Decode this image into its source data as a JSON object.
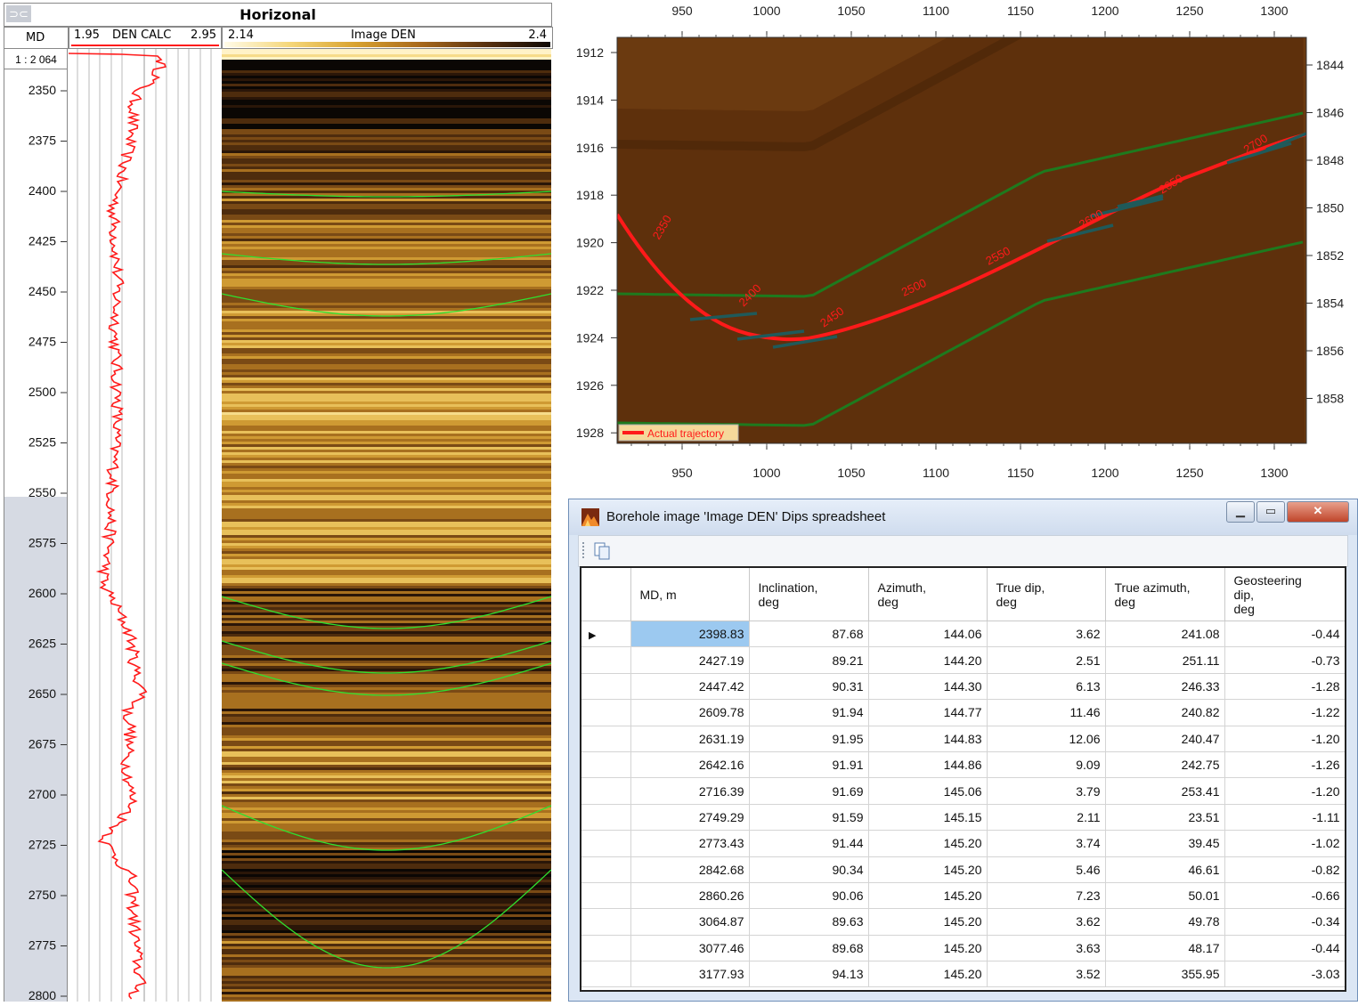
{
  "log_panel": {
    "title": "Horizonal",
    "depth_header": "MD",
    "scale": "1 : 2 064",
    "curve_header": {
      "min": "1.95",
      "name": "DEN CALC",
      "max": "2.95"
    },
    "image_header": {
      "min": "2.14",
      "name": "Image DEN",
      "max": "2.4"
    },
    "depth_labels": [
      "2350",
      "2375",
      "2400",
      "2425",
      "2450",
      "2475",
      "2500",
      "2525",
      "2550",
      "2575",
      "2600",
      "2625",
      "2650",
      "2675",
      "2700",
      "2725",
      "2750",
      "2775",
      "2800"
    ]
  },
  "plot": {
    "x_ticks": [
      "950",
      "1000",
      "1050",
      "1100",
      "1150",
      "1200",
      "1250",
      "1300"
    ],
    "y_left_ticks": [
      "1912",
      "1914",
      "1916",
      "1918",
      "1920",
      "1922",
      "1924",
      "1926",
      "1928"
    ],
    "y_right_ticks": [
      "1844",
      "1846",
      "1848",
      "1850",
      "1852",
      "1854",
      "1856",
      "1858"
    ],
    "trajectory_labels": [
      "2350",
      "2400",
      "2450",
      "2500",
      "2550",
      "2600",
      "2650",
      "2700"
    ],
    "legend": "Actual trajectory",
    "colors": {
      "trajectory": "#ff1a1a",
      "horizon": "#1e7a1e",
      "dip": "#1f5a5a"
    }
  },
  "window": {
    "title": "Borehole image 'Image DEN' Dips spreadsheet",
    "minimize": "▁",
    "maximize": "▭",
    "close": "✕",
    "columns": [
      "MD, m",
      "Inclination,\ndeg",
      "Azimuth,\ndeg",
      "True dip,\ndeg",
      "True azimuth,\ndeg",
      "Geosteering\ndip,\ndeg"
    ],
    "rows": [
      [
        "2398.83",
        "87.68",
        "144.06",
        "3.62",
        "241.08",
        "-0.44"
      ],
      [
        "2427.19",
        "89.21",
        "144.20",
        "2.51",
        "251.11",
        "-0.73"
      ],
      [
        "2447.42",
        "90.31",
        "144.30",
        "6.13",
        "246.33",
        "-1.28"
      ],
      [
        "2609.78",
        "91.94",
        "144.77",
        "11.46",
        "240.82",
        "-1.22"
      ],
      [
        "2631.19",
        "91.95",
        "144.83",
        "12.06",
        "240.47",
        "-1.20"
      ],
      [
        "2642.16",
        "91.91",
        "144.86",
        "9.09",
        "242.75",
        "-1.26"
      ],
      [
        "2716.39",
        "91.69",
        "145.06",
        "3.79",
        "253.41",
        "-1.20"
      ],
      [
        "2749.29",
        "91.59",
        "145.15",
        "2.11",
        "23.51",
        "-1.11"
      ],
      [
        "2773.43",
        "91.44",
        "145.20",
        "3.74",
        "39.45",
        "-1.02"
      ],
      [
        "2842.68",
        "90.34",
        "145.20",
        "5.46",
        "46.61",
        "-0.82"
      ],
      [
        "2860.26",
        "90.06",
        "145.20",
        "7.23",
        "50.01",
        "-0.66"
      ],
      [
        "3064.87",
        "89.63",
        "145.20",
        "3.62",
        "49.78",
        "-0.34"
      ],
      [
        "3077.46",
        "89.68",
        "145.20",
        "3.63",
        "48.17",
        "-0.44"
      ],
      [
        "3177.93",
        "94.13",
        "145.20",
        "3.52",
        "355.95",
        "-3.03"
      ]
    ]
  }
}
